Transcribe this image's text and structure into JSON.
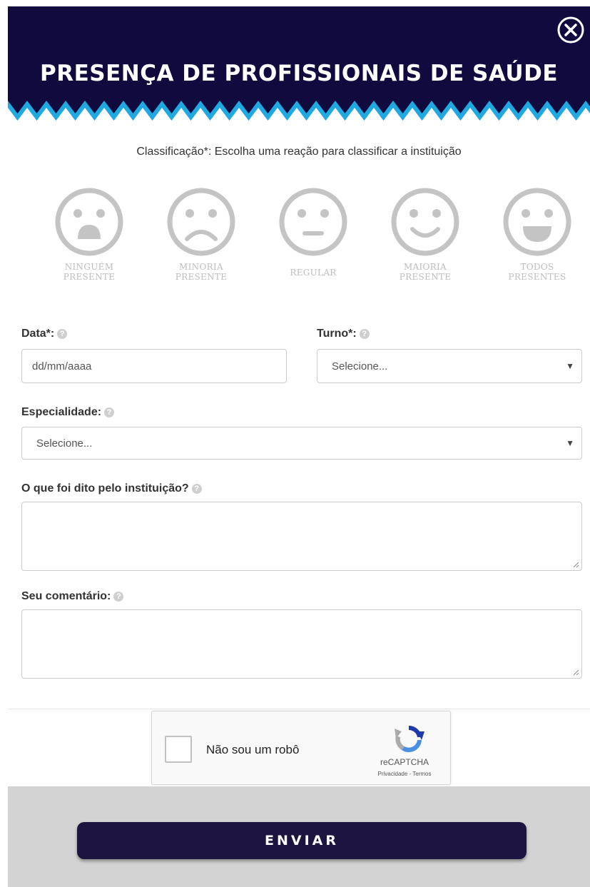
{
  "header": {
    "title": "PRESENÇA DE PROFISSIONAIS DE SAÚDE",
    "close_icon": "close-circle-icon",
    "bg_color": "#110a3f",
    "zigzag_color": "#1fa9e0"
  },
  "rating": {
    "prompt": "Classificação*: Escolha uma reação para classificar a instituição",
    "options": [
      {
        "line1": "NINGUÉM",
        "line2": "PRESENTE",
        "icon": "sad-face-icon"
      },
      {
        "line1": "MINORIA",
        "line2": "PRESENTE",
        "icon": "frown-face-icon"
      },
      {
        "line1": "REGULAR",
        "line2": "",
        "icon": "neutral-face-icon"
      },
      {
        "line1": "MAIORIA",
        "line2": "PRESENTE",
        "icon": "smile-face-icon"
      },
      {
        "line1": "TODOS",
        "line2": "PRESENTES",
        "icon": "laugh-face-icon"
      }
    ]
  },
  "form": {
    "date_label": "Data*:",
    "date_placeholder": "dd/mm/aaaa",
    "shift_label": "Turno*:",
    "shift_value": "Selecione...",
    "specialty_label": "Especialidade:",
    "specialty_value": "Selecione...",
    "said_label": "O que foi dito pelo instituição?",
    "comment_label": "Seu comentário:",
    "help_glyph": "?"
  },
  "captcha": {
    "label": "Não sou um robô",
    "brand": "reCAPTCHA",
    "links": "Privacidade - Termos"
  },
  "footer": {
    "submit_label": "ENVIAR",
    "button_color": "#1d1440"
  }
}
